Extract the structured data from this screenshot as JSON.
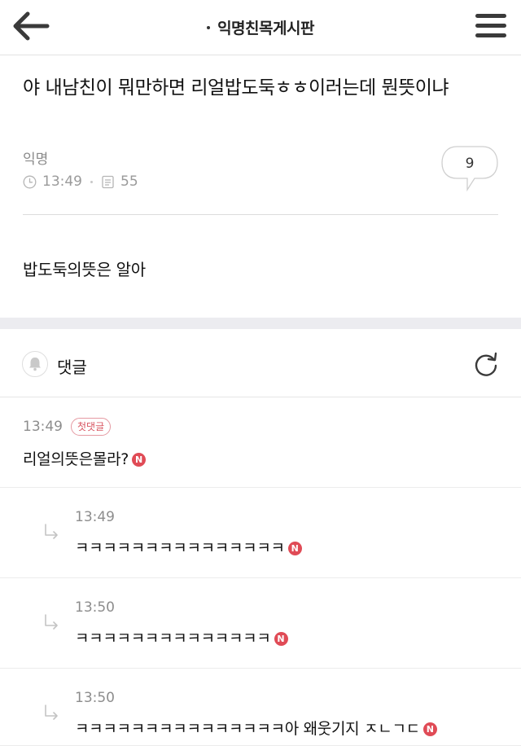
{
  "header": {
    "board_title": "익명친목게시판",
    "back_icon": "back-arrow-icon",
    "menu_icon": "hamburger-menu-icon"
  },
  "post": {
    "title": "야 내남친이 뭐만하면 리얼밥도둑ㅎㅎ이러는데 뭔뜻이냐",
    "author": "익명",
    "time": "13:49",
    "views": "55",
    "comment_count": "9",
    "body": "밥도둑의뜻은 알아"
  },
  "comments_section": {
    "label": "댓글",
    "bell_icon": "bell-icon",
    "refresh_icon": "refresh-icon"
  },
  "comments": [
    {
      "time": "13:49",
      "badge": "첫댓글",
      "text": "리얼의뜻은몰라?",
      "new_label": "N"
    }
  ],
  "replies": [
    {
      "time": "13:49",
      "text": "ㅋㅋㅋㅋㅋㅋㅋㅋㅋㅋㅋㅋㅋㅋㅋ",
      "new_label": "N"
    },
    {
      "time": "13:50",
      "text": "ㅋㅋㅋㅋㅋㅋㅋㅋㅋㅋㅋㅋㅋㅋ",
      "new_label": "N"
    },
    {
      "time": "13:50",
      "text": "ㅋㅋㅋㅋㅋㅋㅋㅋㅋㅋㅋㅋㅋㅋㅋ아 왜웃기지 ㅈㄴㄱㄷ",
      "new_label": "N"
    }
  ],
  "colors": {
    "accent_red": "#e04b56",
    "muted_text": "#8d8d8d",
    "section_gap": "#ececf0"
  }
}
